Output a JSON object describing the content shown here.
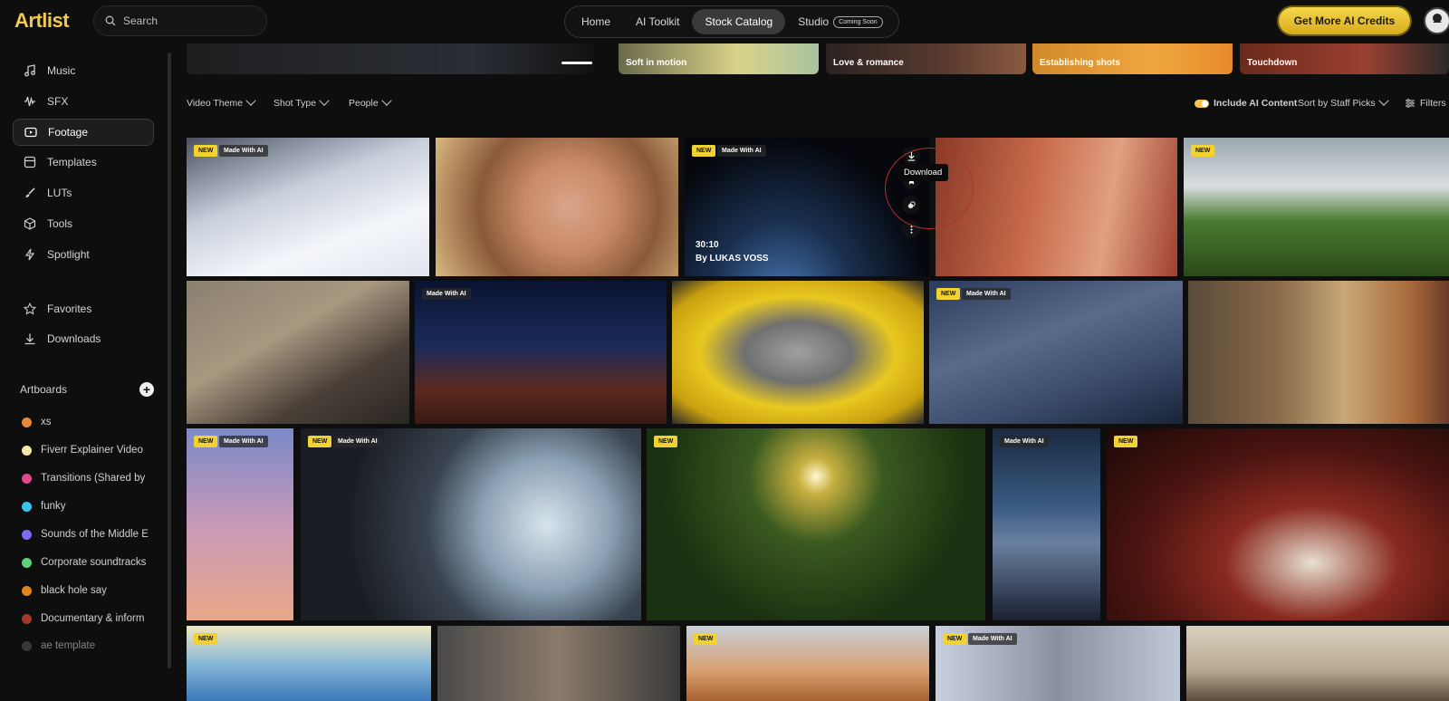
{
  "header": {
    "logo": "Artlist",
    "search_placeholder": "Search",
    "nav": [
      {
        "label": "Home"
      },
      {
        "label": "AI Toolkit"
      },
      {
        "label": "Stock Catalog",
        "active": true
      },
      {
        "label": "Studio",
        "badge": "Coming Soon"
      }
    ],
    "credits_button": "Get More AI Credits"
  },
  "sidebar": {
    "items": [
      {
        "label": "Music",
        "icon": "music-note-icon"
      },
      {
        "label": "SFX",
        "icon": "waveform-icon"
      },
      {
        "label": "Footage",
        "icon": "video-icon",
        "active": true
      },
      {
        "label": "Templates",
        "icon": "templates-icon"
      },
      {
        "label": "LUTs",
        "icon": "brush-icon"
      },
      {
        "label": "Tools",
        "icon": "cube-icon"
      },
      {
        "label": "Spotlight",
        "icon": "lightning-icon"
      },
      {
        "label": "Favorites",
        "icon": "star-icon"
      },
      {
        "label": "Downloads",
        "icon": "download-icon"
      }
    ],
    "artboards_title": "Artboards",
    "artboards": [
      {
        "label": "xs",
        "color": "#e8883a"
      },
      {
        "label": "Fiverr Explainer Video",
        "color": "#f3e9a8"
      },
      {
        "label": "Transitions (Shared by",
        "color": "#e0488a"
      },
      {
        "label": "funky",
        "color": "#39c6e6"
      },
      {
        "label": "Sounds of the Middle E",
        "color": "#7b6cf0"
      },
      {
        "label": "Corporate soundtracks",
        "color": "#5ed17a"
      },
      {
        "label": "black hole say",
        "color": "#e0821e"
      },
      {
        "label": "Documentary & inform",
        "color": "#a23a2a"
      },
      {
        "label": "ae template",
        "color": "#555555"
      }
    ]
  },
  "categories": [
    "Soft in motion",
    "Love & romance",
    "Establishing shots",
    "Touchdown"
  ],
  "filters": {
    "left": [
      "Video Theme",
      "Shot Type",
      "People"
    ],
    "ai_toggle_label": "Include AI Content",
    "sort_label": "Sort by Staff Picks",
    "filters_label": "Filters"
  },
  "tooltip": "Download",
  "badges": {
    "new": "NEW",
    "ai": "Made With AI"
  },
  "hovered_clip": {
    "duration": "30:10",
    "author": "By LUKAS VOSS"
  }
}
